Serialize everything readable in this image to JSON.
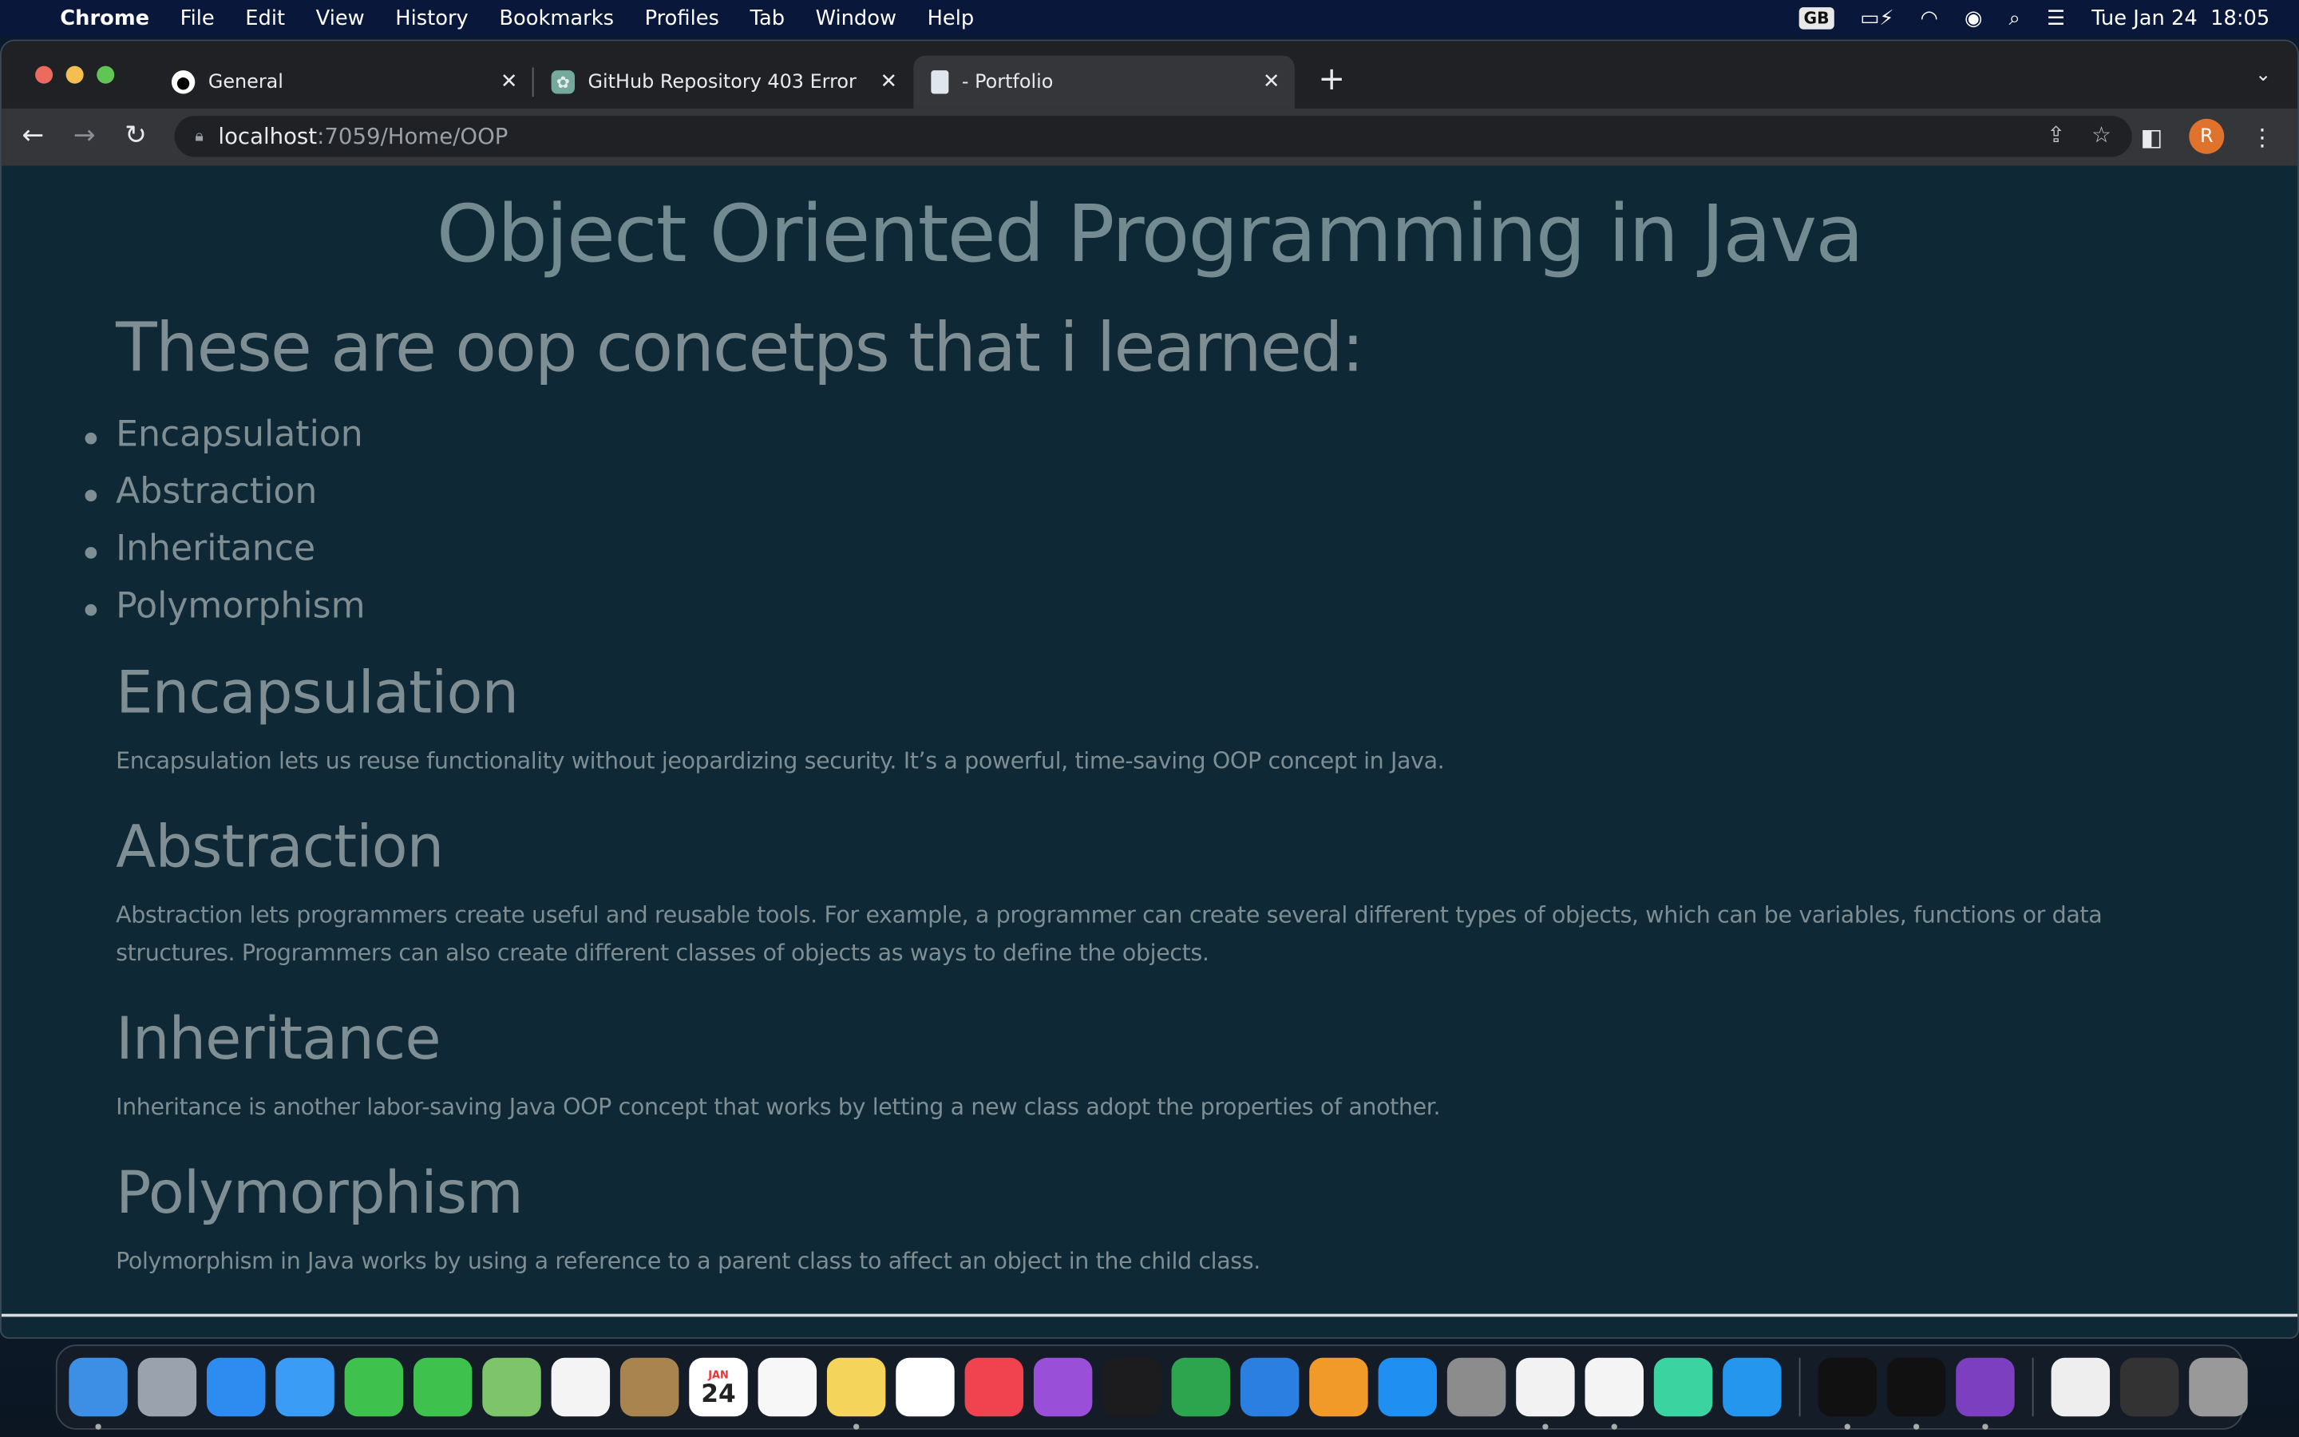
{
  "menubar": {
    "app": "Chrome",
    "items": [
      "File",
      "Edit",
      "View",
      "History",
      "Bookmarks",
      "Profiles",
      "Tab",
      "Window",
      "Help"
    ],
    "input_source": "GB",
    "date": "Tue Jan 24",
    "time": "18:05"
  },
  "tabs": [
    {
      "title": "General",
      "icon": "github-icon",
      "active": false
    },
    {
      "title": "GitHub Repository 403 Error",
      "icon": "chatgpt-icon",
      "active": false
    },
    {
      "title": "- Portfolio",
      "icon": "page-icon",
      "active": true
    }
  ],
  "address": {
    "host": "localhost",
    "rest": ":7059/Home/OOP"
  },
  "profile_initial": "R",
  "page": {
    "title": "Object Oriented Programming in Java",
    "subtitle": "These are oop concetps that i learned:",
    "list": [
      "Encapsulation",
      "Abstraction",
      "Inheritance",
      "Polymorphism"
    ],
    "sections": [
      {
        "heading": "Encapsulation",
        "text": "Encapsulation lets us reuse functionality without jeopardizing security. It’s a powerful, time-saving OOP concept in Java."
      },
      {
        "heading": "Abstraction",
        "text": "Abstraction lets programmers create useful and reusable tools. For example, a programmer can create several different types of objects, which can be variables, functions or data structures. Programmers can also create different classes of objects as ways to define the objects."
      },
      {
        "heading": "Inheritance",
        "text": "Inheritance is another labor-saving Java OOP concept that works by letting a new class adopt the properties of another."
      },
      {
        "heading": "Polymorphism",
        "text": "Polymorphism in Java works by using a reference to a parent class to affect an object in the child class."
      }
    ]
  },
  "dock": {
    "calendar_month": "JAN",
    "calendar_day": "24",
    "apps": [
      "finder",
      "launchpad",
      "safari",
      "mail",
      "facetime",
      "messages",
      "maps",
      "photos",
      "contacts",
      "calendar",
      "reminders",
      "notes",
      "freeform",
      "music",
      "podcasts",
      "tv",
      "numbers",
      "keynote",
      "pages",
      "app-store",
      "system-settings",
      "chrome",
      "visual-studio",
      "datagrip",
      "docker",
      "terminal",
      "activity-monitor",
      "github-desktop",
      "zip-file",
      "downloads-stack",
      "trash"
    ]
  },
  "colors": {
    "page_bg": "#0e2935",
    "text": "#7f8e93",
    "accent_avatar": "#e0732c"
  }
}
